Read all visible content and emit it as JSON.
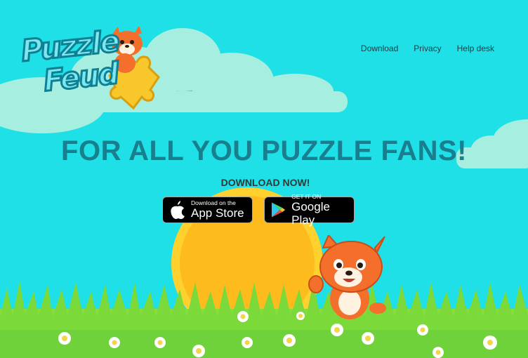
{
  "logo": {
    "line1": "Puzzle",
    "line2": "Feud"
  },
  "nav": {
    "items": [
      "Download",
      "Privacy",
      "Help desk"
    ]
  },
  "hero": {
    "title": "FOR ALL YOU PUZZLE FANS!",
    "subtitle": "DOWNLOAD NOW!"
  },
  "buttons": {
    "appstore": {
      "small": "Download on the",
      "big": "App Store"
    },
    "googleplay": {
      "small": "GET IT ON",
      "big": "Google Play"
    }
  },
  "colors": {
    "sky": "#1fe0e6",
    "title": "#197e8e",
    "sun": "#fdbb1e",
    "grass": "#7bd93a"
  }
}
